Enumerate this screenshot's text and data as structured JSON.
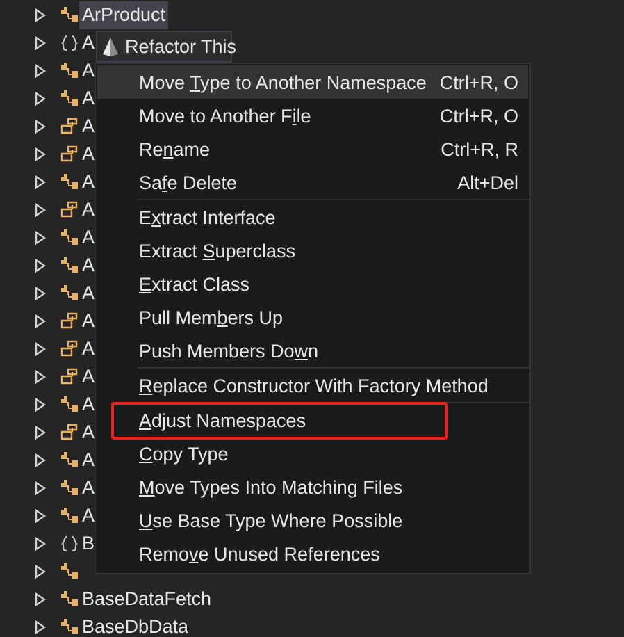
{
  "tree": {
    "items": [
      {
        "kind": "class",
        "label": "ArProduct",
        "selected": true
      },
      {
        "kind": "namespace",
        "label": "A",
        "selected": false
      },
      {
        "kind": "class",
        "label": "A",
        "selected": false
      },
      {
        "kind": "class",
        "label": "A",
        "selected": false
      },
      {
        "kind": "struct",
        "label": "A",
        "selected": false
      },
      {
        "kind": "struct",
        "label": "A",
        "selected": false
      },
      {
        "kind": "class",
        "label": "A",
        "selected": false
      },
      {
        "kind": "struct",
        "label": "A",
        "selected": false
      },
      {
        "kind": "class",
        "label": "A",
        "selected": false
      },
      {
        "kind": "class",
        "label": "A",
        "selected": false
      },
      {
        "kind": "class",
        "label": "A",
        "selected": false
      },
      {
        "kind": "struct",
        "label": "A",
        "selected": false
      },
      {
        "kind": "struct",
        "label": "A",
        "selected": false
      },
      {
        "kind": "struct",
        "label": "A",
        "selected": false
      },
      {
        "kind": "class",
        "label": "A",
        "selected": false
      },
      {
        "kind": "struct",
        "label": "A",
        "selected": false
      },
      {
        "kind": "class",
        "label": "A",
        "selected": false
      },
      {
        "kind": "class",
        "label": "A",
        "selected": false
      },
      {
        "kind": "class",
        "label": "A",
        "selected": false
      },
      {
        "kind": "namespace",
        "label": "B",
        "selected": false
      },
      {
        "kind": "class",
        "selected": false
      },
      {
        "kind": "class",
        "label": "BaseDataFetch",
        "selected": false
      },
      {
        "kind": "class",
        "label": "BaseDbData",
        "selected": false
      }
    ]
  },
  "refactor_popup": {
    "title": "Refactor This"
  },
  "context_menu": {
    "groups": [
      [
        {
          "pre": "Move ",
          "key": "T",
          "post": "ype to Another Namespace",
          "shortcut": "Ctrl+R, O",
          "selected": true,
          "marked": false
        },
        {
          "pre": "Move to Another F",
          "key": "i",
          "post": "le",
          "shortcut": "Ctrl+R, O",
          "selected": false,
          "marked": false
        },
        {
          "pre": "Re",
          "key": "n",
          "post": "ame",
          "shortcut": "Ctrl+R, R",
          "selected": false,
          "marked": false
        },
        {
          "pre": "Sa",
          "key": "f",
          "post": "e Delete",
          "shortcut": "Alt+Del",
          "selected": false,
          "marked": false
        }
      ],
      [
        {
          "pre": "E",
          "key": "x",
          "post": "tract Interface",
          "selected": false,
          "marked": false
        },
        {
          "pre": "Extract ",
          "key": "S",
          "post": "uperclass",
          "selected": false,
          "marked": false
        },
        {
          "key": "E",
          "post": "xtract Class",
          "selected": false,
          "marked": false
        },
        {
          "pre": "Pull Mem",
          "key": "b",
          "post": "ers Up",
          "selected": false,
          "marked": false
        },
        {
          "pre": "Push Members Do",
          "key": "w",
          "post": "n",
          "selected": false,
          "marked": false
        }
      ],
      [
        {
          "key": "R",
          "post": "eplace Constructor With Factory Method",
          "selected": false,
          "marked": false
        }
      ],
      [
        {
          "key": "A",
          "post": "djust Namespaces",
          "selected": false,
          "marked": true
        },
        {
          "key": "C",
          "post": "opy Type",
          "selected": false,
          "marked": false
        },
        {
          "key": "M",
          "post": "ove Types Into Matching Files",
          "selected": false,
          "marked": false
        },
        {
          "key": "U",
          "post": "se Base Type Where Possible",
          "selected": false,
          "marked": false
        },
        {
          "pre": "Remo",
          "key": "v",
          "post": "e Unused References",
          "selected": false,
          "marked": false
        }
      ]
    ]
  }
}
